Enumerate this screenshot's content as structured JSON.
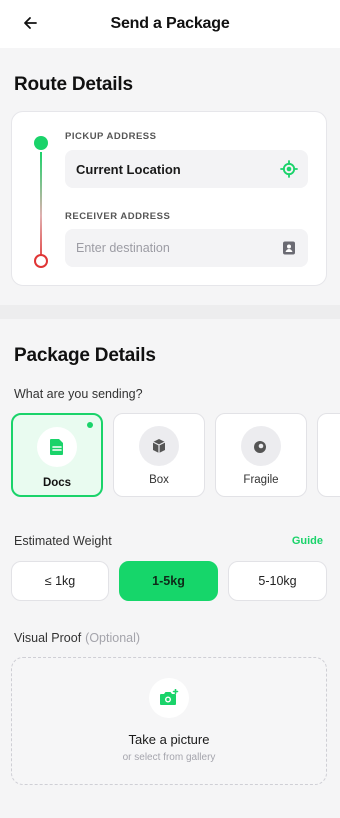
{
  "header": {
    "title": "Send a Package",
    "back_icon": "arrow-left-icon"
  },
  "route": {
    "section_title": "Route Details",
    "pickup": {
      "label": "PICKUP ADDRESS",
      "value": "Current Location",
      "icon": "locate-target-icon"
    },
    "receiver": {
      "label": "RECEIVER ADDRESS",
      "placeholder": "Enter destination",
      "icon": "contact-book-icon"
    }
  },
  "package": {
    "section_title": "Package Details",
    "question": "What are you sending?",
    "types": [
      {
        "label": "Docs",
        "icon": "document-icon",
        "selected": true
      },
      {
        "label": "Box",
        "icon": "cube-box-icon",
        "selected": false
      },
      {
        "label": "Fragile",
        "icon": "fragile-icon",
        "selected": false
      }
    ]
  },
  "weight": {
    "title": "Estimated Weight",
    "guide_label": "Guide",
    "options": [
      {
        "label": "≤ 1kg",
        "selected": false
      },
      {
        "label": "1-5kg",
        "selected": true
      },
      {
        "label": "5-10kg",
        "selected": false
      }
    ]
  },
  "proof": {
    "title": "Visual Proof",
    "optional": "(Optional)",
    "main_text": "Take a picture",
    "sub_text": "or select from gallery",
    "icon": "camera-add-icon"
  },
  "colors": {
    "accent": "#1ad36a",
    "danger": "#e03535",
    "background": "#f5f5f6"
  }
}
